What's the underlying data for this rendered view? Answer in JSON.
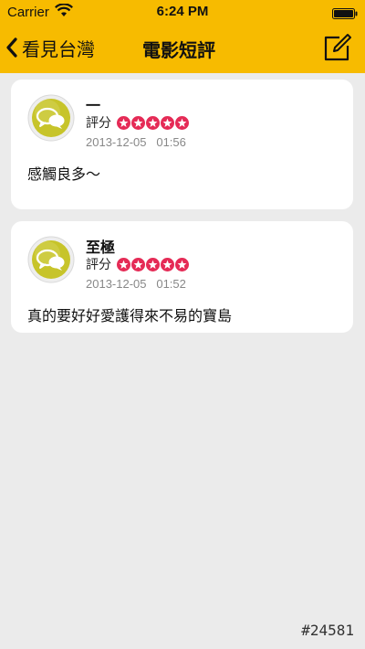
{
  "status_bar": {
    "carrier": "Carrier",
    "time": "6:24 PM"
  },
  "nav": {
    "back_label": "看見台灣",
    "title": "電影短評",
    "back_icon": "chevron-left-icon",
    "compose_icon": "compose-icon"
  },
  "colors": {
    "header": "#f7bb00",
    "star": "#e52b56",
    "background": "#ebebeb"
  },
  "reviews": [
    {
      "author": "一",
      "rating_label": "評分",
      "rating": 5,
      "timestamp": "2013-12-05   01:56",
      "text": "感觸良多～"
    },
    {
      "author": "至極",
      "rating_label": "評分",
      "rating": 5,
      "timestamp": "2013-12-05   01:52",
      "text": "真的要好好愛護得來不易的寶島"
    }
  ],
  "watermark": "#24581"
}
